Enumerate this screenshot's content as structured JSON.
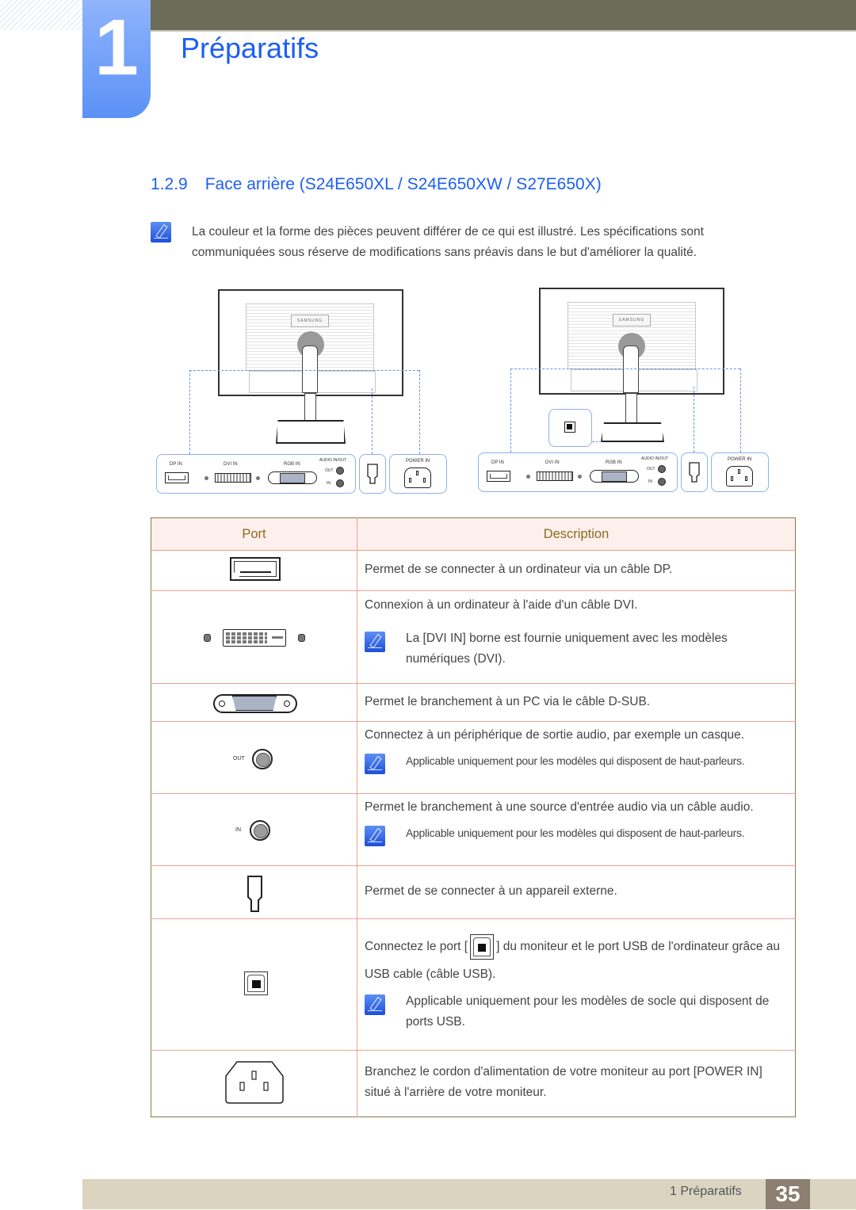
{
  "chapter": {
    "number": "1",
    "title": "Préparatifs"
  },
  "section": {
    "number": "1.2.9",
    "title": "Face arrière (S24E650XL / S24E650XW / S27E650X)"
  },
  "intro_note": {
    "icon": "note-pencil-icon",
    "text": "La couleur et la forme des pièces peuvent différer de ce qui est illustré. Les spécifications sont communiquées sous réserve de modifications sans préavis dans le but d'améliorer la qualité."
  },
  "diagrams": [
    {
      "name": "monitor-back-without-usb",
      "logo": "SAMSUNG",
      "labels": {
        "dp": "DP IN",
        "dvi": "DVI IN",
        "rgb": "RGB IN",
        "audio": "AUDIO IN/OUT",
        "out": "OUT",
        "in": "IN",
        "power": "POWER IN"
      }
    },
    {
      "name": "monitor-back-with-usb",
      "logo": "SAMSUNG",
      "labels": {
        "dp": "DP IN",
        "dvi": "DVI IN",
        "rgb": "RGB IN",
        "audio": "AUDIO IN/OUT",
        "out": "OUT",
        "in": "IN",
        "power": "POWER IN"
      }
    }
  ],
  "table": {
    "headers": {
      "port": "Port",
      "description": "Description"
    },
    "rows": [
      {
        "port_icon": "displayport-icon",
        "description": "Permet de se connecter à un ordinateur via un câble DP."
      },
      {
        "port_icon": "dvi-port-icon",
        "description": "Connexion à un ordinateur à l'aide d'un câble DVI.",
        "note": "La [DVI IN] borne est fournie uniquement avec les modèles numériques (DVI)."
      },
      {
        "port_icon": "vga-dsub-port-icon",
        "description": "Permet le branchement à un PC via le câble D-SUB."
      },
      {
        "port_icon": "audio-out-jack-icon",
        "port_label": "OUT",
        "description": "Connectez à un périphérique de sortie audio, par exemple un casque.",
        "note": "Applicable uniquement pour les modèles qui disposent de haut-parleurs."
      },
      {
        "port_icon": "audio-in-jack-icon",
        "port_label": "IN",
        "description": "Permet le branchement à une source d'entrée audio via un câble audio.",
        "note": "Applicable uniquement pour les modèles qui disposent de haut-parleurs."
      },
      {
        "port_icon": "service-port-icon",
        "description": "Permet de se connecter à un appareil externe."
      },
      {
        "port_icon": "usb-b-port-icon",
        "description_before": "Connectez le port [",
        "description_after": "] du moniteur et le port USB de l'ordinateur grâce au USB cable (câble USB).",
        "note": "Applicable uniquement pour les modèles de socle qui disposent de ports USB."
      },
      {
        "port_icon": "power-in-port-icon",
        "description": "Branchez le cordon d'alimentation de votre moniteur au port [POWER IN] situé à l'arrière de votre moniteur."
      }
    ]
  },
  "footer": {
    "chapter_label": "1 Préparatifs",
    "page": "35"
  },
  "colors": {
    "accent_blue": "#1d5ef5",
    "header_bar": "#6d6c58",
    "table_header_text": "#8a6a20",
    "table_border": "#eca28f",
    "footer_bar": "#dad4c0",
    "page_box": "#8c7f71"
  }
}
